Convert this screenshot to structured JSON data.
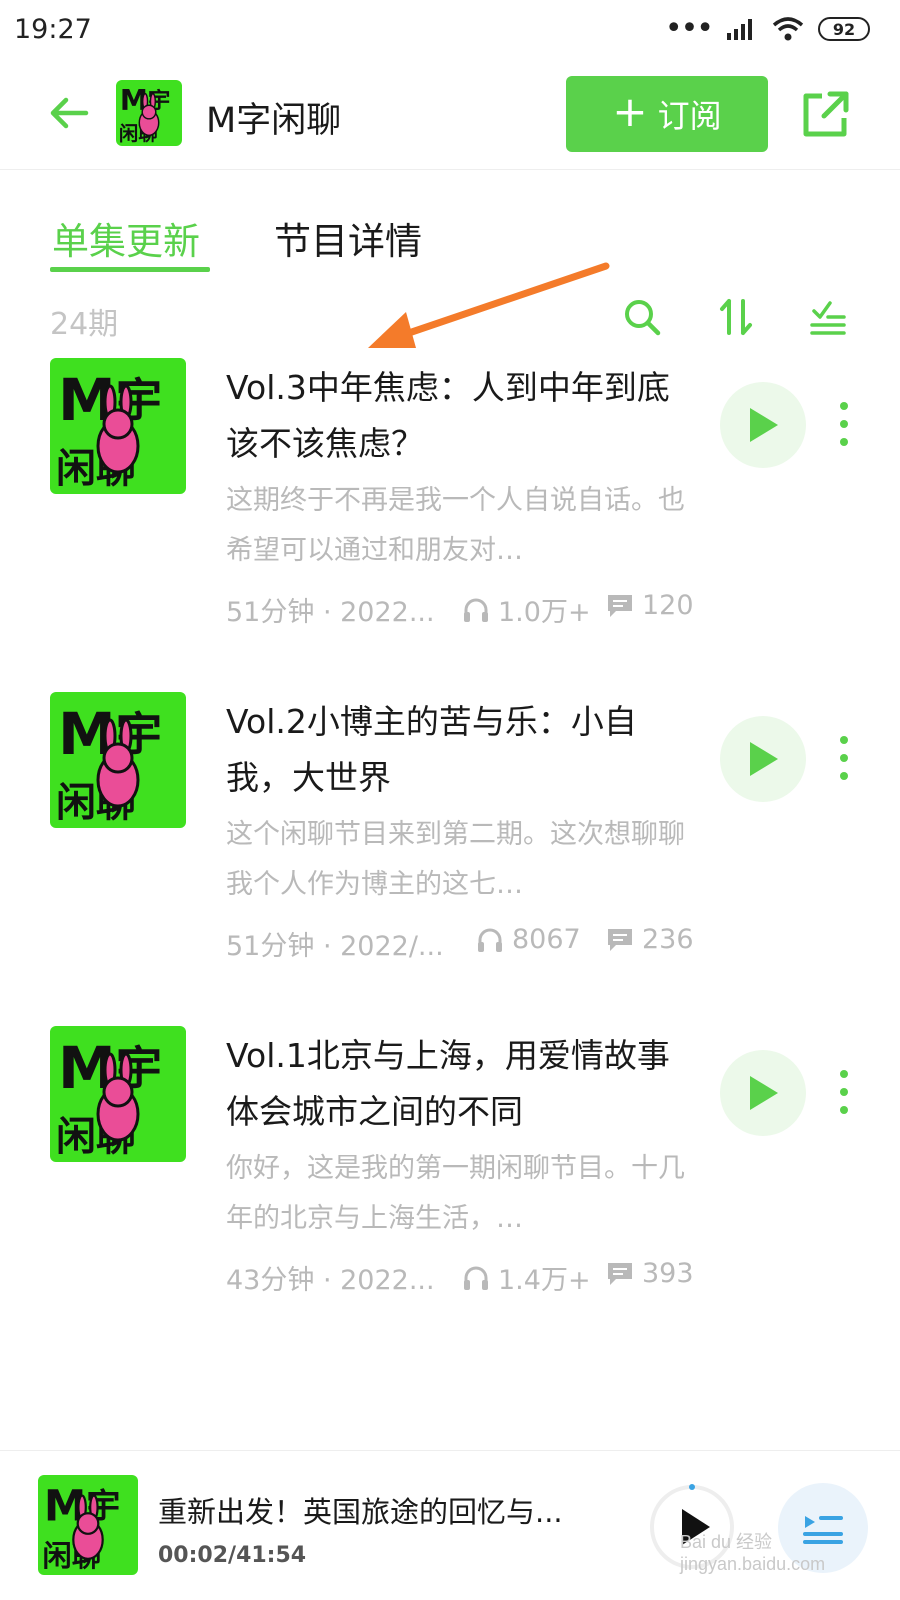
{
  "status_bar": {
    "time": "19:27",
    "battery": "92",
    "dots": "•••"
  },
  "header": {
    "title": "M字闲聊",
    "subscribe_label": "订阅",
    "subscribe_plus": "+"
  },
  "tabs": [
    {
      "label": "单集更新",
      "active": true
    },
    {
      "label": "节目详情",
      "active": false
    }
  ],
  "toolbar": {
    "episode_count": "24期"
  },
  "episodes": [
    {
      "title": "Vol.3中年焦虑：人到中年到底该不该焦虑？",
      "description": "这期终于不再是我一个人自说自话。也希望可以通过和朋友对…",
      "duration_date": "51分钟 · 2022...",
      "listens": "1.0万+",
      "comments": "120"
    },
    {
      "title": "Vol.2小博主的苦与乐：小自我，大世界",
      "description": "这个闲聊节目来到第二期。这次想聊聊我个人作为博主的这七…",
      "duration_date": "51分钟 · 2022/...",
      "listens": "8067",
      "comments": "236"
    },
    {
      "title": "Vol.1北京与上海，用爱情故事体会城市之间的不同",
      "description": "你好，这是我的第一期闲聊节目。十几年的北京与上海生活，…",
      "duration_date": "43分钟 · 2022...",
      "listens": "1.4万+",
      "comments": "393"
    }
  ],
  "mini_player": {
    "title": "重新出发！英国旅途的回忆与...",
    "time": "00:02/41:54"
  },
  "watermark": "Bai du 经验  jingyan.baidu.com",
  "colors": {
    "accent": "#5ad14b",
    "cover_green": "#3fe01f",
    "bunny_pink": "#ea4d97",
    "arrow": "#f47b2a"
  },
  "icons": [
    "back-arrow-icon",
    "share-icon",
    "search-icon",
    "sort-icon",
    "filter-icon",
    "play-icon",
    "more-vertical-icon",
    "headphones-icon",
    "comment-icon",
    "playlist-icon"
  ]
}
